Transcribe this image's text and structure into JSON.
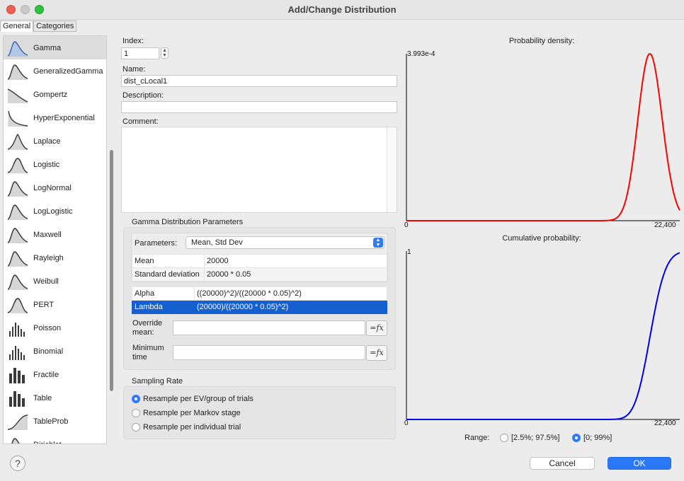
{
  "window": {
    "title": "Add/Change Distribution"
  },
  "tabs": [
    {
      "label": "General",
      "active": true
    },
    {
      "label": "Categories",
      "active": false
    }
  ],
  "distributions": [
    {
      "label": "Gamma",
      "icon": "curve-skew-icon",
      "selected": true
    },
    {
      "label": "GeneralizedGamma",
      "icon": "curve-skew-icon"
    },
    {
      "label": "Gompertz",
      "icon": "curve-decay-icon"
    },
    {
      "label": "HyperExponential",
      "icon": "curve-exp-icon"
    },
    {
      "label": "Laplace",
      "icon": "curve-peak-icon"
    },
    {
      "label": "Logistic",
      "icon": "curve-bell-icon"
    },
    {
      "label": "LogNormal",
      "icon": "curve-skew-icon"
    },
    {
      "label": "LogLogistic",
      "icon": "curve-skew-icon"
    },
    {
      "label": "Maxwell",
      "icon": "curve-skew-icon"
    },
    {
      "label": "Rayleigh",
      "icon": "curve-skew-icon"
    },
    {
      "label": "Weibull",
      "icon": "curve-skew-icon"
    },
    {
      "label": "PERT",
      "icon": "curve-bell-icon"
    },
    {
      "label": "Poisson",
      "icon": "bars-icon"
    },
    {
      "label": "Binomial",
      "icon": "bars-icon"
    },
    {
      "label": "Fractile",
      "icon": "bars-block-icon"
    },
    {
      "label": "Table",
      "icon": "bars-block-icon"
    },
    {
      "label": "TableProb",
      "icon": "curve-sshape-icon"
    },
    {
      "label": "Dirichlet",
      "icon": "curve-skew-icon"
    }
  ],
  "form": {
    "index_label": "Index:",
    "index_value": "1",
    "name_label": "Name:",
    "name_value": "dist_cLocal1",
    "description_label": "Description:",
    "description_value": "",
    "comment_label": "Comment:",
    "comment_value": ""
  },
  "params": {
    "group_title": "Gamma Distribution Parameters",
    "parameters_label": "Parameters:",
    "parameters_value": "Mean, Std Dev",
    "inputs": [
      {
        "name": "Mean",
        "value": "20000"
      },
      {
        "name": "Standard deviation",
        "value": "20000 * 0.05"
      }
    ],
    "derived": [
      {
        "name": "Alpha",
        "value": "((20000)^2)/((20000 * 0.05)^2)",
        "selected": false
      },
      {
        "name": "Lambda",
        "value": "(20000)/((20000 * 0.05)^2)",
        "selected": true
      }
    ],
    "override_label_1": "Override",
    "override_label_2": "mean:",
    "override_value": "",
    "minimum_label_1": "Minimum",
    "minimum_label_2": "time",
    "minimum_value": "",
    "fx_label": "=fx"
  },
  "sampling": {
    "title": "Sampling Rate",
    "options": [
      {
        "label": "Resample per EV/group of trials",
        "selected": true
      },
      {
        "label": "Resample per Markov stage",
        "selected": false
      },
      {
        "label": "Resample per individual trial",
        "selected": false
      }
    ]
  },
  "charts": {
    "range_label": "Range:",
    "range_options": [
      {
        "label": "[2.5%; 97.5%]",
        "selected": false
      },
      {
        "label": "[0; 99%]",
        "selected": true
      }
    ]
  },
  "chart_data": [
    {
      "type": "line",
      "title": "Probability density:",
      "ymax_label": "3.993e-4",
      "xmin_label": "0",
      "xmax_label": "22,400",
      "xlim": [
        0,
        22400
      ],
      "ylim": [
        0,
        0.0003993
      ],
      "color": "#ff0000",
      "grid": false,
      "distribution": {
        "family": "gamma",
        "mean": 20000,
        "sd": 1000
      }
    },
    {
      "type": "line",
      "title": "Cumulative probability:",
      "ymax_label": "1",
      "xmin_label": "0",
      "xmax_label": "22,400",
      "xlim": [
        0,
        22400
      ],
      "ylim": [
        0,
        1
      ],
      "color": "#0000e6",
      "grid": false,
      "distribution": {
        "family": "gamma",
        "mean": 20000,
        "sd": 1000
      }
    }
  ],
  "buttons": {
    "cancel": "Cancel",
    "ok": "OK",
    "help": "?"
  }
}
